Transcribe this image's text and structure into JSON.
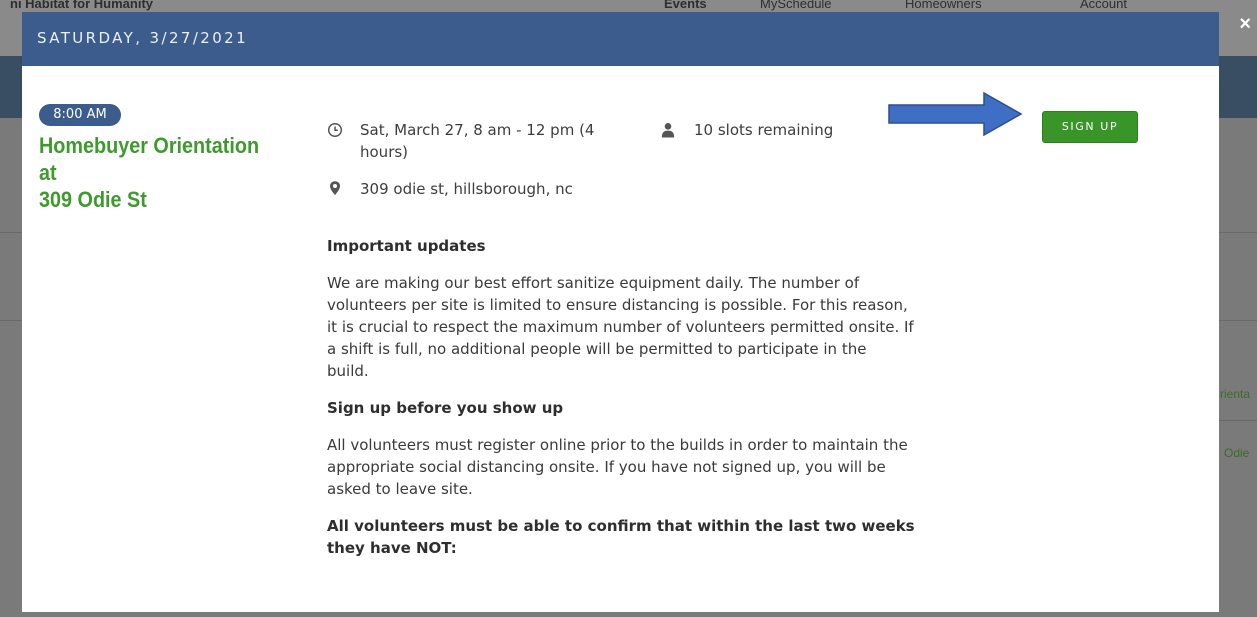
{
  "background": {
    "top_left_text": "ni Habitat for Humanity",
    "nav_items": [
      "Events",
      "MySchedule",
      "Homeowners",
      "Account"
    ],
    "right_links": [
      "rienta",
      "Odie"
    ]
  },
  "modal": {
    "date_header": "SATURDAY, 3/27/2021",
    "close_label": "×",
    "event": {
      "time_badge": "8:00 AM",
      "title_line1": "Homebuyer Orientation at",
      "title_line2": "309 Odie St",
      "when_line1": "Sat, March 27, 8 am - 12 pm (4",
      "when_line2": "hours)",
      "slots": "10 slots remaining",
      "location": "309 odie st, hillsborough, nc",
      "signup_label": "SIGN UP"
    },
    "body": {
      "heading1": "Important updates",
      "para1_lines": [
        "We are making our best effort sanitize equipment daily.  The number of",
        "volunteers per site is limited to ensure distancing is possible. For this reason,",
        "it is crucial to respect the maximum number of volunteers permitted onsite. If",
        "a shift is full, no additional people will be permitted to participate in the",
        "build."
      ],
      "heading2": "Sign up before you show up",
      "para2_lines": [
        "All volunteers must register online prior to the builds in order to maintain the",
        "appropriate social distancing onsite. If you have not signed up, you will be",
        "asked to leave site."
      ],
      "heading3_line1": "All volunteers must be able to confirm that within the last two weeks",
      "heading3_line2": "they have NOT:"
    }
  },
  "colors": {
    "header_blue": "#3b5c8c",
    "green_accent": "#3e9a2c",
    "button_green": "#3a9528",
    "arrow_blue": "#3f6fc4"
  },
  "icons": [
    "clock-icon",
    "person-icon",
    "map-pin-icon",
    "arrow-right-icon",
    "close-icon"
  ]
}
